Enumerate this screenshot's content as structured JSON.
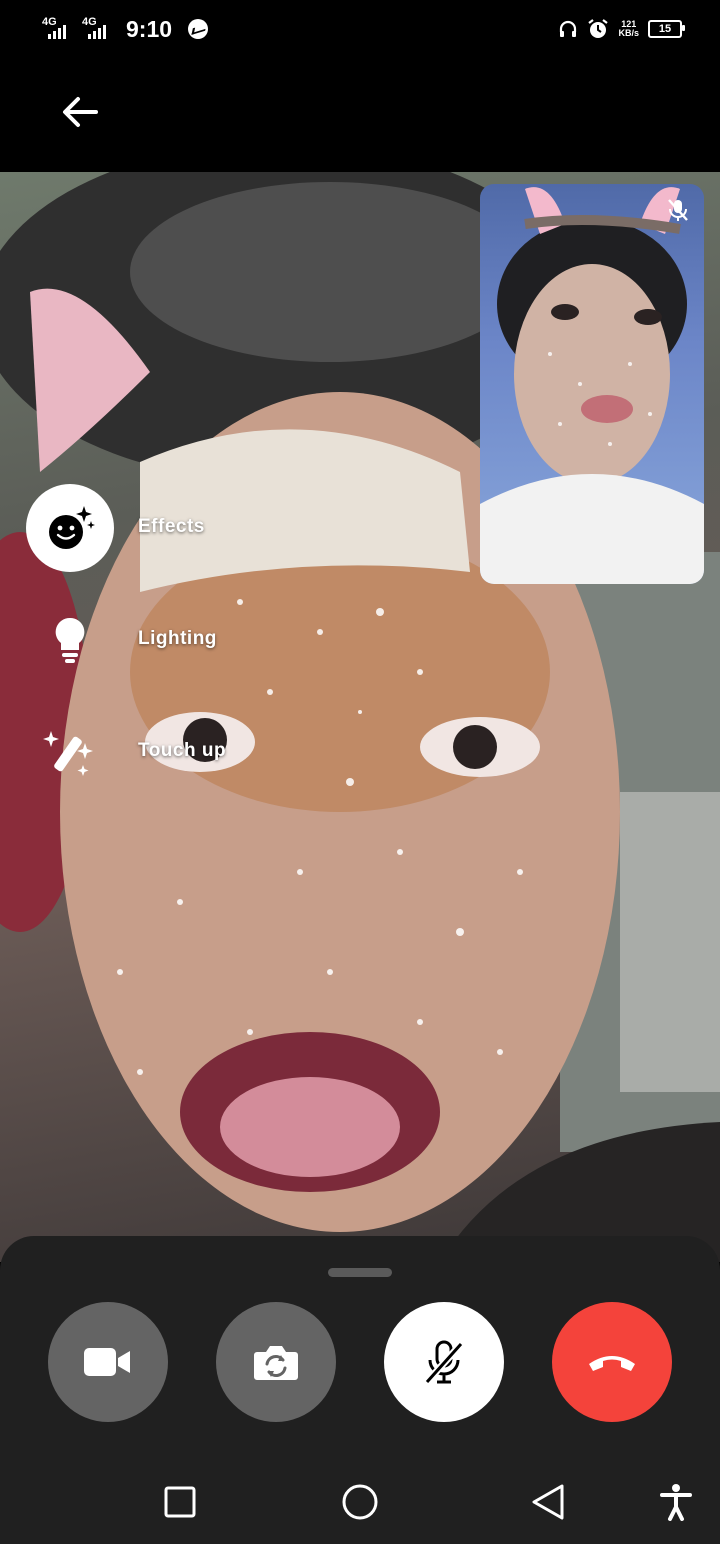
{
  "status_bar": {
    "network_1": "4G",
    "network_2": "4G",
    "time": "9:10",
    "speed_value": "121",
    "speed_unit": "KB/s",
    "battery": "15",
    "icons": [
      "messenger-icon",
      "headphones-icon",
      "alarm-icon"
    ]
  },
  "header": {
    "back_icon": "arrow-left-icon"
  },
  "effects_menu": {
    "items": [
      {
        "label": "Effects",
        "icon": "effects-face-sparkle-icon",
        "active": true
      },
      {
        "label": "Lighting",
        "icon": "lightbulb-icon",
        "active": false
      },
      {
        "label": "Touch up",
        "icon": "magic-wand-icon",
        "active": false
      }
    ]
  },
  "self_view": {
    "muted_icon": "mic-off-icon"
  },
  "call_controls": {
    "buttons": [
      {
        "name": "video-toggle",
        "icon": "video-camera-icon",
        "color": "#646464"
      },
      {
        "name": "flip-camera",
        "icon": "camera-flip-icon",
        "color": "#646464"
      },
      {
        "name": "mute",
        "icon": "mic-off-icon",
        "color": "#ffffff"
      },
      {
        "name": "end-call",
        "icon": "phone-hangup-icon",
        "color": "#f4433b"
      }
    ]
  },
  "nav_bar": {
    "icons": [
      "recents-square-icon",
      "home-circle-icon",
      "back-triangle-icon",
      "accessibility-icon"
    ]
  }
}
